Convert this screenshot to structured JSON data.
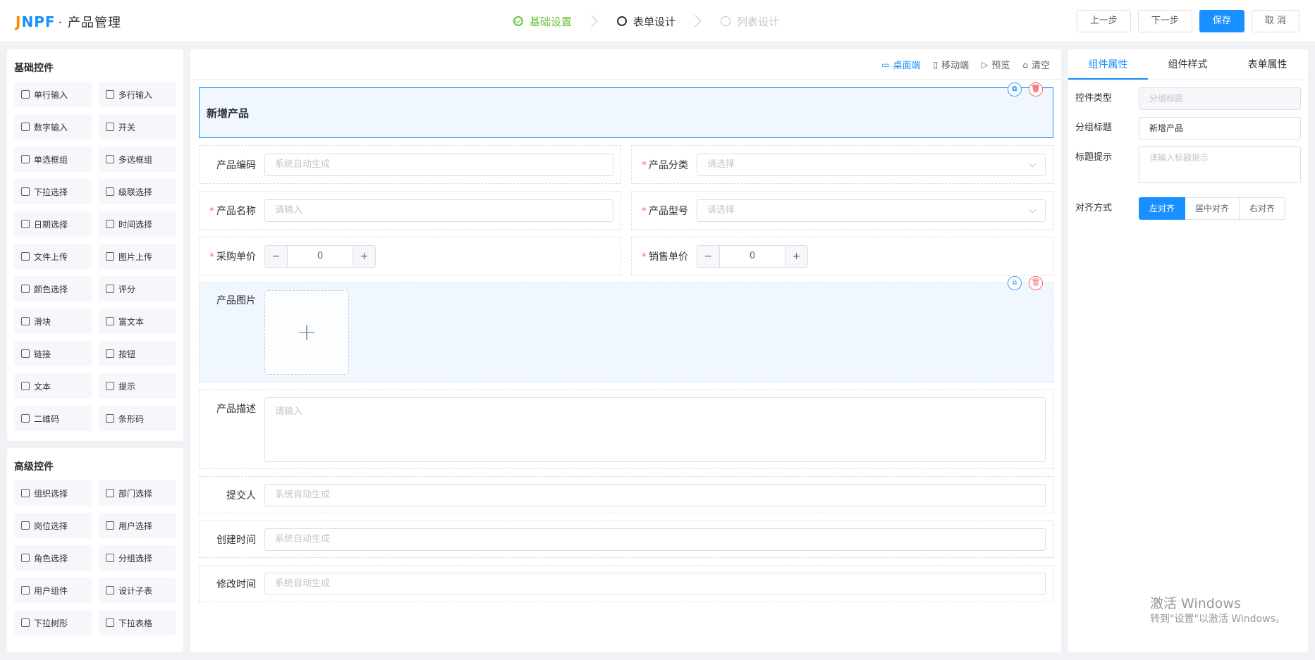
{
  "header": {
    "logo": "JNPF",
    "app_title": "产品管理",
    "steps": [
      {
        "label": "基础设置",
        "state": "done"
      },
      {
        "label": "表单设计",
        "state": "active"
      },
      {
        "label": "列表设计",
        "state": "todo"
      }
    ],
    "buttons": {
      "prev": "上一步",
      "next": "下一步",
      "save": "保存",
      "cancel": "取 消"
    }
  },
  "basic_controls": {
    "title": "基础控件",
    "items": [
      "单行输入",
      "多行输入",
      "数字输入",
      "开关",
      "单选框组",
      "多选框组",
      "下拉选择",
      "级联选择",
      "日期选择",
      "时间选择",
      "文件上传",
      "图片上传",
      "颜色选择",
      "评分",
      "滑块",
      "富文本",
      "链接",
      "按钮",
      "文本",
      "提示",
      "二维码",
      "条形码"
    ]
  },
  "advanced_controls": {
    "title": "高级控件",
    "items": [
      "组织选择",
      "部门选择",
      "岗位选择",
      "用户选择",
      "角色选择",
      "分组选择",
      "用户组件",
      "设计子表",
      "下拉树形",
      "下拉表格"
    ]
  },
  "canvas_toolbar": {
    "desktop": "桌面端",
    "mobile": "移动端",
    "preview": "预览",
    "clear": "清空"
  },
  "form": {
    "group_title": "新增产品",
    "fields": {
      "code": {
        "label": "产品编码",
        "placeholder": "系统自动生成"
      },
      "category": {
        "label": "产品分类",
        "placeholder": "请选择"
      },
      "name": {
        "label": "产品名称",
        "placeholder": "请输入"
      },
      "model": {
        "label": "产品型号",
        "placeholder": "请选择"
      },
      "purchase_price": {
        "label": "采购单价",
        "value": "0"
      },
      "sale_price": {
        "label": "销售单价",
        "value": "0"
      },
      "image": {
        "label": "产品图片"
      },
      "description": {
        "label": "产品描述",
        "placeholder": "请输入"
      },
      "submitter": {
        "label": "提交人",
        "placeholder": "系统自动生成"
      },
      "created": {
        "label": "创建时间",
        "placeholder": "系统自动生成"
      },
      "modified": {
        "label": "修改时间",
        "placeholder": "系统自动生成"
      }
    }
  },
  "properties": {
    "tabs": [
      "组件属性",
      "组件样式",
      "表单属性"
    ],
    "control_type": {
      "label": "控件类型",
      "value": "分组标题"
    },
    "group_title": {
      "label": "分组标题",
      "value": "新增产品"
    },
    "title_hint": {
      "label": "标题提示",
      "placeholder": "请输入标题提示"
    },
    "align": {
      "label": "对齐方式",
      "options": [
        "左对齐",
        "居中对齐",
        "右对齐"
      ]
    }
  },
  "watermark": {
    "line1": "激活 Windows",
    "line2": "转到\"设置\"以激活 Windows。"
  }
}
